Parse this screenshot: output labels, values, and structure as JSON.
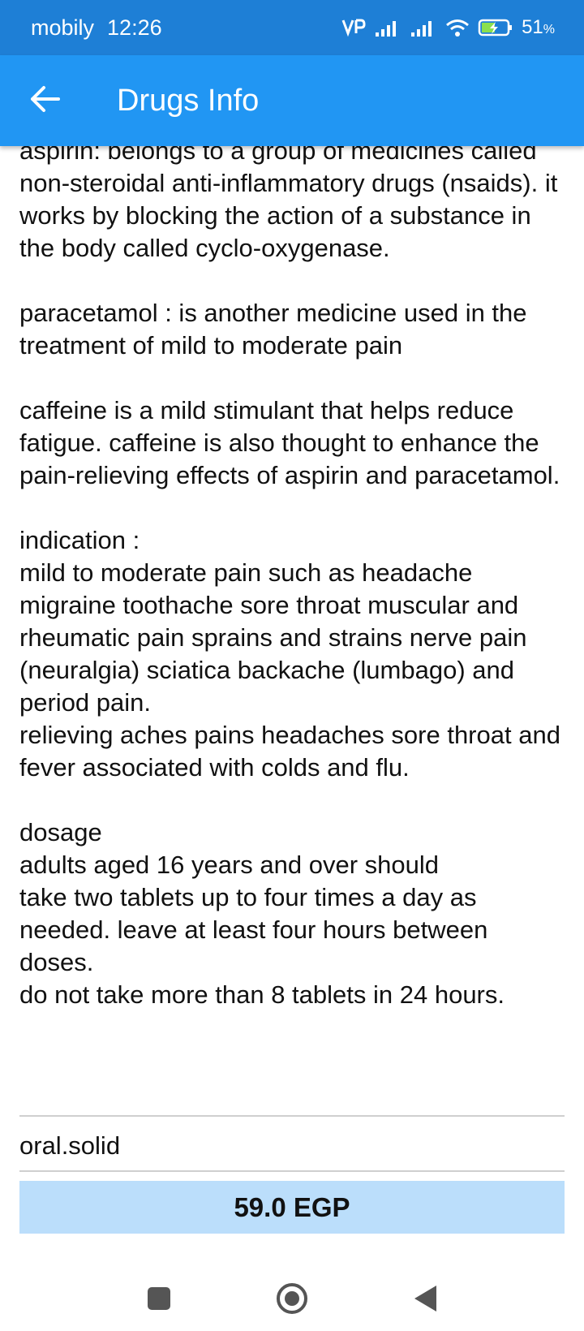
{
  "status_bar": {
    "carrier": "mobily",
    "time": "12:26",
    "battery": "51",
    "battery_unit": "%"
  },
  "app_bar": {
    "title": "Drugs Info",
    "back_icon": "arrow-left-icon"
  },
  "description": [
    "aspirin: belongs to a group of medicines called non-steroidal anti-inflammatory drugs (nsaids). it works by blocking the action of a substance in the body called cyclo-oxygenase.",
    "paracetamol : is another medicine used in the treatment of mild to moderate pain",
    "caffeine is a mild stimulant that helps reduce fatigue. caffeine is also thought to enhance the pain-relieving effects of aspirin and paracetamol.",
    "indication :\nmild to moderate pain   such as headache   migraine   toothache   sore throat   muscular and rheumatic pain   sprains and strains   nerve pain (neuralgia)   sciatica   backache (lumbago) and period pain.\nrelieving aches   pains   headaches   sore throat and fever associated with colds and flu.",
    "dosage\nadults aged 16 years and over should\ntake two tablets up to four times a day as needed. leave at least four hours between doses.\ndo not take more than 8 tablets in 24 hours."
  ],
  "route": "oral.solid",
  "price": "59.0 EGP",
  "colors": {
    "status_bar": "#1e7fd6",
    "app_bar": "#2196f3",
    "price_bg": "#bbdefb"
  },
  "nav_icons": [
    "square-recents-icon",
    "circle-home-icon",
    "triangle-back-icon"
  ]
}
